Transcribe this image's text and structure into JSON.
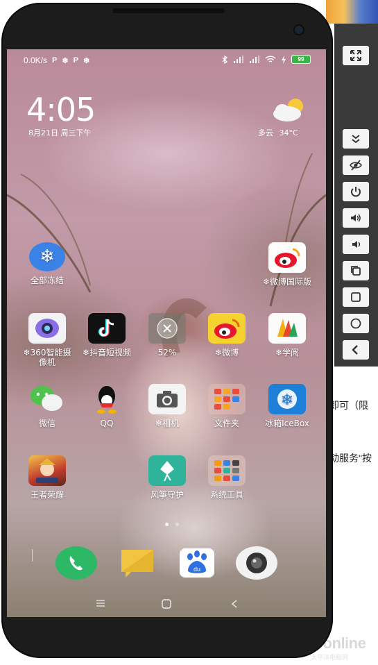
{
  "background_page": {
    "text_line_1": "即可（限",
    "text_line_2": "动服务\"按",
    "watermark": "PConline",
    "watermark_sub": "太平洋电脑网"
  },
  "emulator_toolbar": {
    "buttons": [
      {
        "name": "fullscreen",
        "icon": "fullscreen-icon"
      },
      {
        "name": "collapse",
        "icon": "chevrons-down-icon"
      },
      {
        "name": "hide",
        "icon": "eye-off-icon"
      },
      {
        "name": "power",
        "icon": "power-icon"
      },
      {
        "name": "volume-up",
        "icon": "volume-up-icon"
      },
      {
        "name": "volume-down",
        "icon": "volume-down-icon"
      },
      {
        "name": "recents",
        "icon": "recents-icon"
      },
      {
        "name": "overview",
        "icon": "square-icon"
      },
      {
        "name": "home",
        "icon": "circle-icon"
      },
      {
        "name": "back",
        "icon": "back-icon"
      }
    ]
  },
  "status_bar": {
    "speed": "0.0K/s",
    "left_icons": [
      "P",
      "❄",
      "P",
      "❄"
    ],
    "battery": "99"
  },
  "lockscreen": {
    "time": "4:05",
    "date": "8月21日 周三下午",
    "weather": {
      "condition": "多云",
      "temperature": "34°C"
    }
  },
  "apps": {
    "freeze_all": "全部冻结",
    "weibo_intl": "❄微博国际版",
    "cam360": "❄360智能摄像机",
    "douyin": "❄抖音短视频",
    "cleaner_percent": "52%",
    "weibo": "❄微博",
    "xueyue": "❄学阅",
    "wechat": "微信",
    "qq": "QQ",
    "camera": "❄相机",
    "folder": "文件夹",
    "icebox": "冰箱IceBox",
    "honor_of_kings": "王者荣耀",
    "guard": "风筝守护",
    "sys_tools": "系统工具"
  },
  "colors": {
    "phone_body": "#1c1c1c",
    "side_panel": "#3a3a3a",
    "dock_phone": "#2db866",
    "dock_message": "#f1c540",
    "battery": "#3bb54a"
  }
}
